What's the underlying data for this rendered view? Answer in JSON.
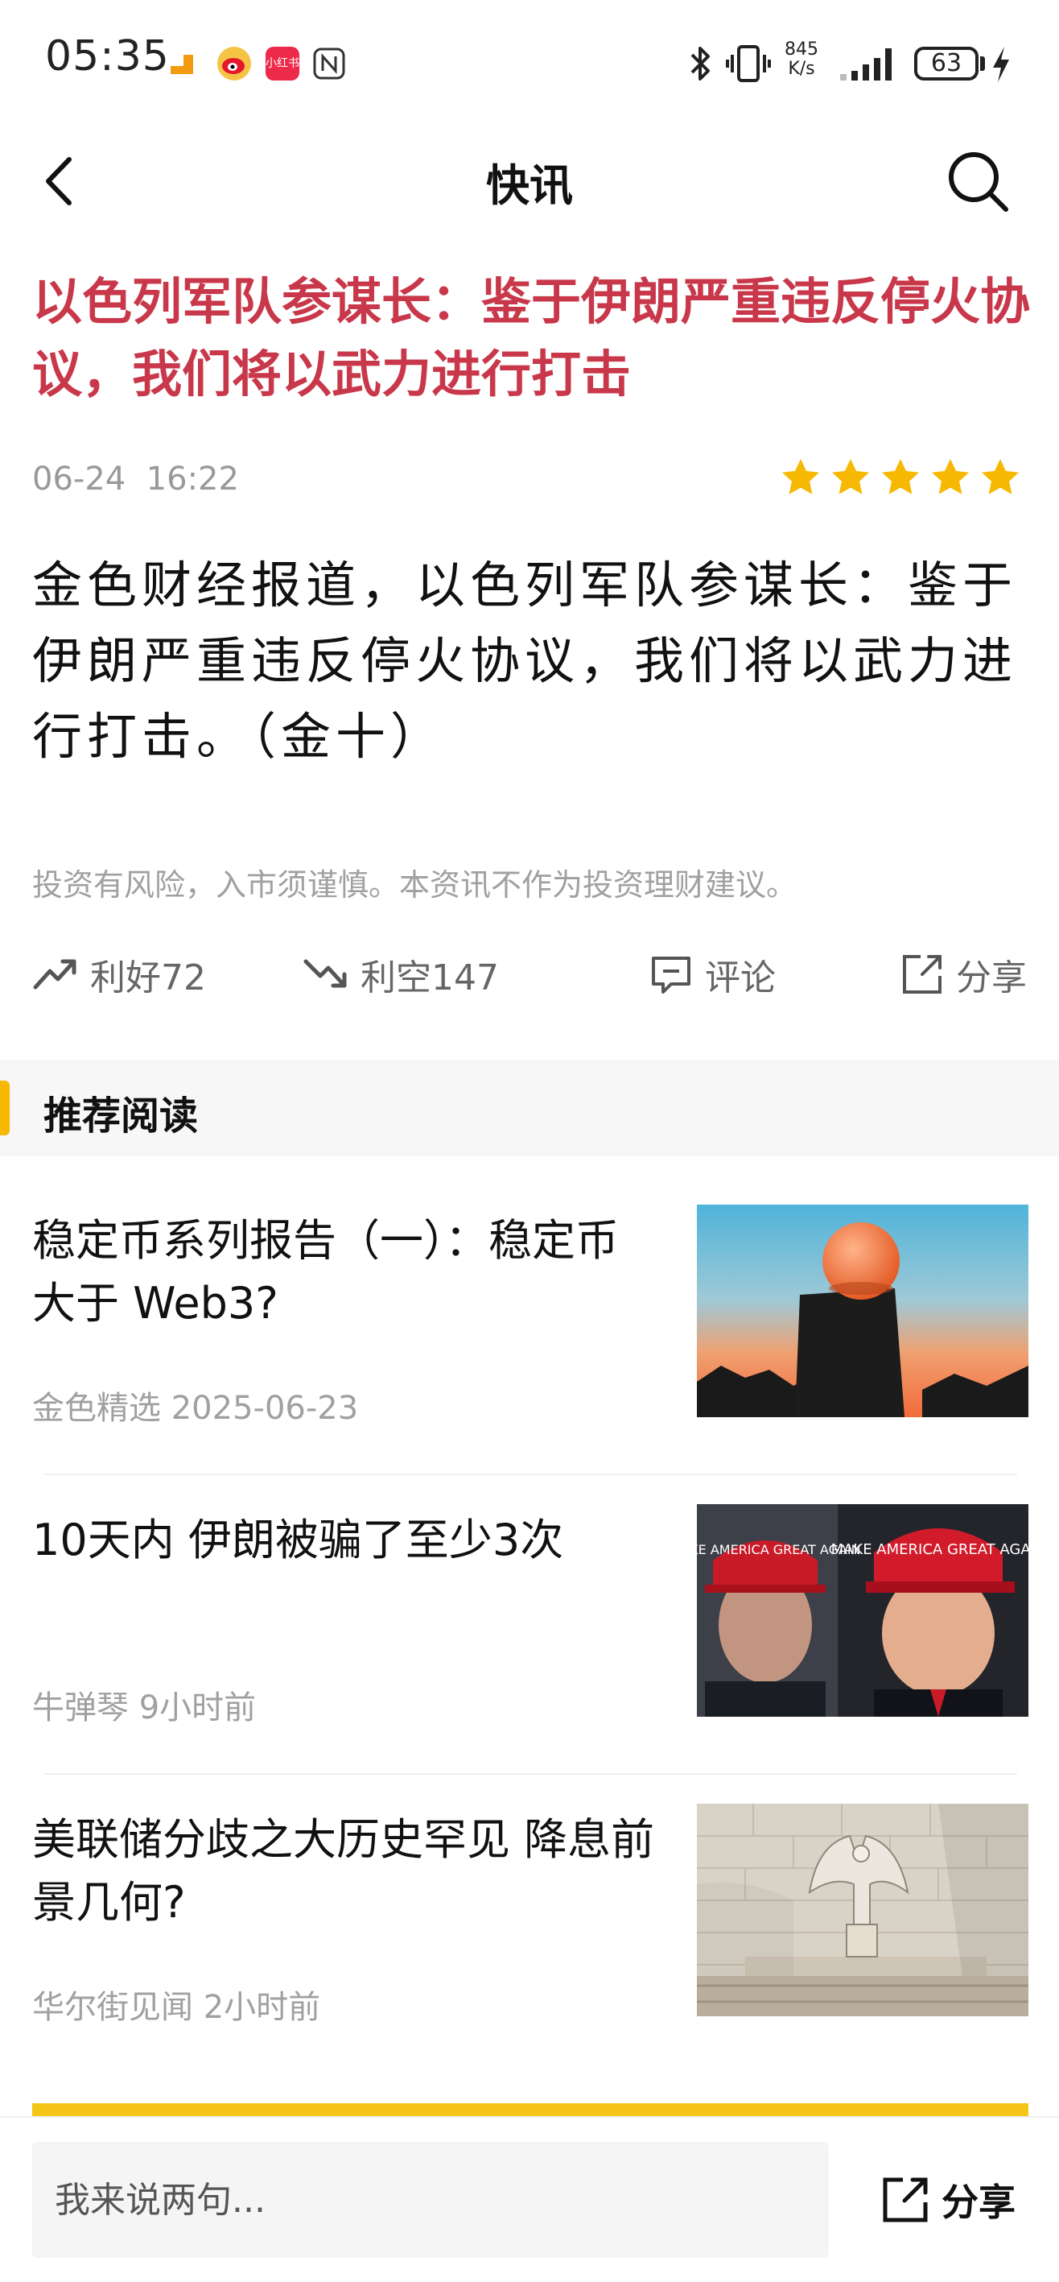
{
  "status_bar": {
    "time": "05:35",
    "speed_value": "845",
    "speed_unit": "K/s",
    "battery": "63",
    "xiaohongshu_label": "小红书"
  },
  "header": {
    "title": "快讯"
  },
  "article": {
    "headline": "以色列军队参谋长：鉴于伊朗严重违反停火协议，我们将以武力进行打击",
    "date": "06-24",
    "time": "16:22",
    "rating": 5,
    "body": "金色财经报道，以色列军队参谋长：鉴于伊朗严重违反停火协议，我们将以武力进行打击。（金十）",
    "disclaimer": "投资有风险，入市须谨慎。本资讯不作为投资理财建议。"
  },
  "actions": {
    "bullish_label": "利好72",
    "bearish_label": "利空147",
    "comment_label": "评论",
    "share_label": "分享"
  },
  "recommended": {
    "title": "推荐阅读",
    "items": [
      {
        "title": "稳定币系列报告（一）：稳定币大于 Web3?",
        "source": "金色精选",
        "time": "2025-06-23"
      },
      {
        "title": "10天内 伊朗被骗了至少3次",
        "source": "牛弹琴",
        "time": "9小时前",
        "cap_text": "MAKE AMERICA GREAT AGAIN"
      },
      {
        "title": "美联储分歧之大历史罕见 降息前景几何?",
        "source": "华尔街见闻",
        "time": "2小时前"
      }
    ]
  },
  "bottom_bar": {
    "comment_placeholder": "我来说两句...",
    "share_label": "分享"
  },
  "colors": {
    "headline": "#c8384a",
    "star": "#f6b800",
    "accent_bar": "#f6b800"
  }
}
